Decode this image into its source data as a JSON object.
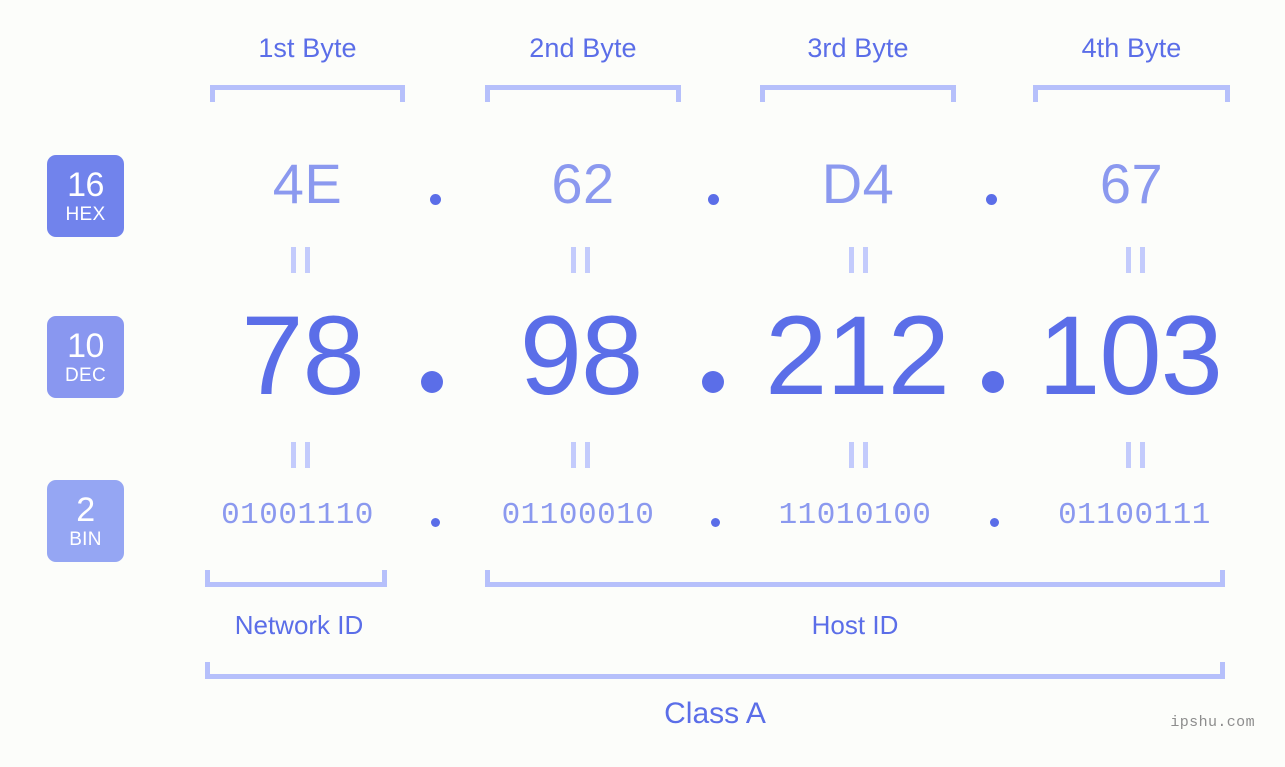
{
  "background_color": "#fcfdfa",
  "accent_color": "#5b6ee8",
  "light_accent_color": "#8b99ef",
  "bracket_color": "#b6c0fb",
  "byte_headers": [
    {
      "label": "1st Byte"
    },
    {
      "label": "2nd Byte"
    },
    {
      "label": "3rd Byte"
    },
    {
      "label": "4th Byte"
    }
  ],
  "rows": {
    "hex": {
      "badge_number": "16",
      "badge_name": "HEX",
      "badge_color": "#7183ec",
      "values": [
        "4E",
        "62",
        "D4",
        "67"
      ],
      "separator": "."
    },
    "dec": {
      "badge_number": "10",
      "badge_name": "DEC",
      "badge_color": "#8997f0",
      "values": [
        "78",
        "98",
        "212",
        "103"
      ],
      "separator": "."
    },
    "bin": {
      "badge_number": "2",
      "badge_name": "BIN",
      "badge_color": "#95a6f3",
      "values": [
        "01001110",
        "01100010",
        "11010100",
        "01100111"
      ],
      "separator": "."
    }
  },
  "equals_marks": {
    "glyph": "II",
    "count_per_row": 4
  },
  "id_sections": [
    {
      "label": "Network ID"
    },
    {
      "label": "Host ID"
    }
  ],
  "class_label": "Class A",
  "watermark": "ipshu.com"
}
